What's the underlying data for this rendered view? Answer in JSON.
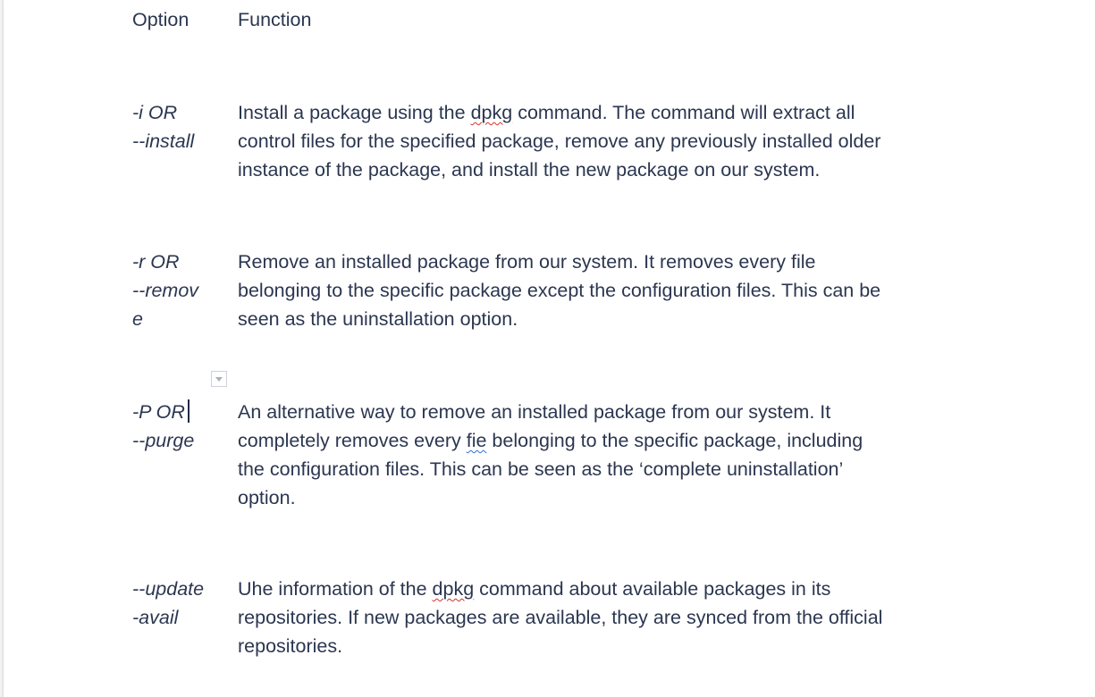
{
  "table": {
    "header": {
      "option": "Option",
      "function": "Function"
    },
    "rows": [
      {
        "option_lines": [
          "-i OR",
          "--install"
        ],
        "function_lines": [
          "Install a package using the",
          "dpkg",
          "command. The command will extract all",
          "control files for the specified package, remove any previously installed older",
          "instance of the package, and install the new package on our system."
        ]
      },
      {
        "option_lines": [
          "-r OR",
          "--remov",
          "e"
        ],
        "function_lines": [
          "Remove an installed package from our system. It removes every file",
          "belonging to the specific package except the configuration files. This can be",
          "seen as the uninstallation option."
        ]
      },
      {
        "option_lines": [
          "-P OR",
          "--purge"
        ],
        "function_lines": [
          "An alternative way to remove an installed package from our system. It",
          "completely removes every",
          "fie",
          "belonging to the specific package, including",
          "the configuration files. This can be seen as the ‘complete uninstallation’",
          "option."
        ]
      },
      {
        "option_lines": [
          "--update",
          "-avail"
        ],
        "function_lines": [
          "Uhe information of the",
          "dpkg",
          "command about available packages in its",
          "repositories. If new packages are available, they are synced from the official",
          "repositories."
        ]
      }
    ]
  },
  "colors": {
    "text": "#2b3650",
    "spellcheck_red": "#d93025",
    "grammar_blue": "#2f6fd1",
    "page_background": "#ffffff"
  }
}
